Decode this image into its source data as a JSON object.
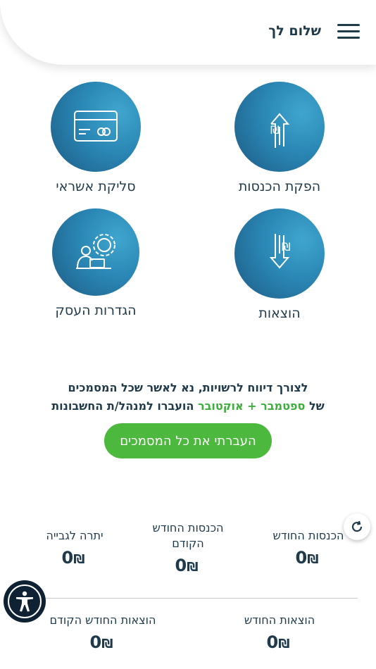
{
  "header": {
    "greeting": "שלום לך"
  },
  "tiles": [
    {
      "label": "הפקת הכנסות",
      "icon": "arrow-up-shekel-icon"
    },
    {
      "label": "סליקת אשראי",
      "icon": "credit-card-icon"
    },
    {
      "label": "הוצאות",
      "icon": "arrow-down-shekel-icon"
    },
    {
      "label": "הגדרות העסק",
      "icon": "business-settings-icon"
    }
  ],
  "notice": {
    "line1": "לצורך דיווח לרשויות, נא לאשר שכל המסמכים",
    "line2_prefix": "של",
    "line2_months": "ספטמבר + אוקטובר",
    "line2_suffix": "הועברו למנהל/ת החשבונות"
  },
  "cta_label": "העברתי את כל המסמכים",
  "stats": [
    {
      "title": "הכנסות החודש",
      "value": "0",
      "currency": "₪"
    },
    {
      "title": "הכנסות החודש הקודם",
      "value": "0",
      "currency": "₪"
    },
    {
      "title": "יתרה לגבייה",
      "value": "0",
      "currency": "₪"
    },
    {
      "title": "הוצאות החודש",
      "value": "0",
      "currency": "₪"
    },
    {
      "title": "הוצאות החודש הקודם",
      "value": "0",
      "currency": "₪"
    }
  ],
  "colors": {
    "primary": "#2a86b4",
    "accent_green": "#4cb83d",
    "text": "#1f3a4a"
  }
}
